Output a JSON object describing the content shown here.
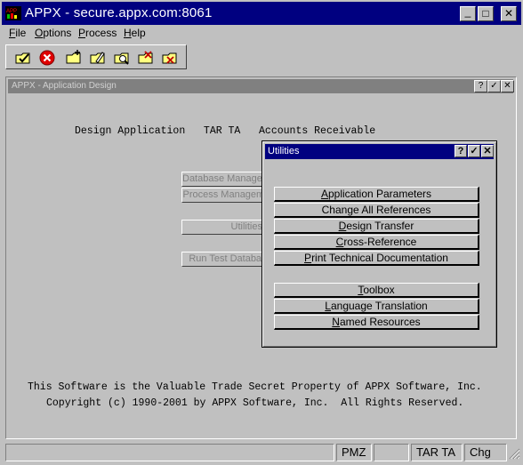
{
  "window": {
    "title": "APPX - secure.appx.com:8061",
    "controls": {
      "minimize": "_",
      "maximize": "□",
      "close": "✕"
    }
  },
  "menu": [
    {
      "label": "File",
      "accel": "F",
      "rest": "ile"
    },
    {
      "label": "Options",
      "accel": "O",
      "rest": "ptions"
    },
    {
      "label": "Process",
      "accel": "P",
      "rest": "rocess"
    },
    {
      "label": "Help",
      "accel": "H",
      "rest": "elp"
    }
  ],
  "toolbar": {
    "icons": [
      "check-folder-icon",
      "cancel-icon",
      "new-folder-icon",
      "edit-folder-icon",
      "search-folder-icon",
      "delete-folder-icon",
      "folder-x-icon"
    ]
  },
  "child_window": {
    "title": "APPX - Application Design",
    "controls": {
      "help": "?",
      "ok": "✓",
      "close": "✕"
    },
    "header_text": "Design Application   TAR TA   Accounts Receivable",
    "buttons": [
      "Database Management",
      "Process Management",
      "Utilities",
      "Run Test Database"
    ],
    "footer_line1": "This Software is the Valuable Trade Secret Property of APPX Software, Inc.",
    "footer_line2": "Copyright (c) 1990-2001 by APPX Software, Inc.  All Rights Reserved."
  },
  "utilities_dialog": {
    "title": "Utilities",
    "controls": {
      "help": "?",
      "ok": "✓",
      "close": "✕"
    },
    "group1": [
      {
        "label": "Application Parameters",
        "accel": "A"
      },
      {
        "label": "Change All References",
        "accel": ""
      },
      {
        "label": "Design Transfer",
        "accel": "D"
      },
      {
        "label": "Cross-Reference",
        "accel": "C"
      },
      {
        "label": "Print Technical Documentation",
        "accel": "P"
      }
    ],
    "group2": [
      {
        "label": "Toolbox",
        "accel": "T"
      },
      {
        "label": "Language Translation",
        "accel": "L"
      },
      {
        "label": "Named Resources",
        "accel": "N"
      }
    ]
  },
  "statusbar": {
    "panels": [
      "",
      "",
      "PMZ",
      "",
      "TAR TA",
      "Chg"
    ]
  }
}
